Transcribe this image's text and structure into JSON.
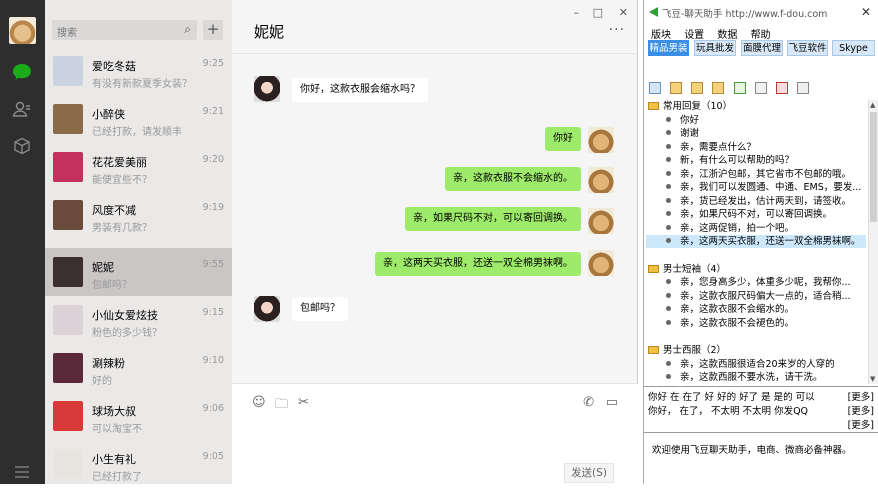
{
  "sidebar": {
    "search_placeholder": "搜索",
    "add_label": "+",
    "contacts": [
      {
        "name": "爱吃冬菇",
        "time": "9:25",
        "preview": "有没有新款夏季女装？",
        "avatar_color": "#c9d4e0"
      },
      {
        "name": "小醉侠",
        "time": "9:21",
        "preview": "已经打款，请发顺丰",
        "avatar_color": "#8b6a4a"
      },
      {
        "name": "花花爱美丽",
        "time": "9:20",
        "preview": "能便宜些不？",
        "avatar_color": "#c43060"
      },
      {
        "name": "风度不减",
        "time": "9:19",
        "preview": "男装有几款？",
        "avatar_color": "#6a4a3a"
      },
      {
        "name": "妮妮",
        "time": "9:55",
        "preview": "包邮吗？",
        "avatar_color": "#3a3030"
      },
      {
        "name": "小仙女爱炫技",
        "time": "9:15",
        "preview": "粉色的多少钱？",
        "avatar_color": "#d9d2d6"
      },
      {
        "name": "涮辣粉",
        "time": "9:10",
        "preview": "好的",
        "avatar_color": "#5a2a3a"
      },
      {
        "name": "球场大叔",
        "time": "9:06",
        "preview": "可以淘宝不",
        "avatar_color": "#d83a3a"
      },
      {
        "name": "小生有礼",
        "time": "9:05",
        "preview": "已经打款了",
        "avatar_color": "#e8e4e0"
      }
    ]
  },
  "chat": {
    "title": "妮妮",
    "more": "···",
    "window_min": "–",
    "window_max": "□",
    "window_close": "✕",
    "messages": [
      {
        "side": "left",
        "text": "你好，这款衣服会缩水吗？"
      },
      {
        "side": "right",
        "text": "你好"
      },
      {
        "side": "right",
        "text": "亲，这款衣服不会缩水的。"
      },
      {
        "side": "right",
        "text": "亲，如果尺码不对，可以寄回调换。"
      },
      {
        "side": "right",
        "text": "亲，这两天买衣服，还送一双全棉男袜啊。"
      },
      {
        "side": "left",
        "text": "包邮吗？"
      }
    ],
    "send_label": "发送(S)"
  },
  "panel": {
    "title": "飞豆-聊天助手  http://www.f-dou.com",
    "close": "✕",
    "menu": [
      "版块",
      "设置",
      "数据",
      "帮助"
    ],
    "tabs": [
      "精品男装",
      "玩具批发",
      "面膜代理",
      "飞豆软件",
      "Skype"
    ],
    "tree": [
      {
        "kind": "group",
        "text": "常用回复（10）"
      },
      {
        "kind": "item",
        "text": "你好"
      },
      {
        "kind": "item",
        "text": "谢谢"
      },
      {
        "kind": "item",
        "text": "亲，需要点什么？"
      },
      {
        "kind": "item",
        "text": "新，有什么可以帮助的吗？"
      },
      {
        "kind": "item",
        "text": "亲，江浙沪包邮，其它省市不包邮的哦。"
      },
      {
        "kind": "item",
        "text": "亲，我们可以发圆通、中通、EMS，要发..."
      },
      {
        "kind": "item",
        "text": "亲，货已经发出，估计两天到，请签收。"
      },
      {
        "kind": "item",
        "text": "亲，如果尺码不对，可以寄回调换。"
      },
      {
        "kind": "item",
        "text": "亲，这两促销，拍一个吧。"
      },
      {
        "kind": "item",
        "text": "亲，这两天买衣服，还送一双全棉男袜啊。",
        "selected": true
      },
      {
        "kind": "blank",
        "text": ""
      },
      {
        "kind": "group",
        "text": "男士短袖（4）"
      },
      {
        "kind": "item",
        "text": "亲，您身高多少，体重多少呢，我帮你..."
      },
      {
        "kind": "item",
        "text": "亲，这款衣服尺码偏大一点的，适合稍..."
      },
      {
        "kind": "item",
        "text": "亲，这款衣服不会缩水的。"
      },
      {
        "kind": "item",
        "text": "亲，这款衣服不会褪色的。"
      },
      {
        "kind": "blank",
        "text": ""
      },
      {
        "kind": "group",
        "text": "男士西服（2）"
      },
      {
        "kind": "item",
        "text": "亲，这款西服很适合20来岁的人穿的"
      },
      {
        "kind": "item",
        "text": "亲，这款西服不要水洗，请干洗。"
      }
    ],
    "quick_lines": [
      {
        "text": "你好  在  在了  好  好的  好了  是  是的  可以",
        "more": "[更多]"
      },
      {
        "text": "你好，   在了，   不太明   不太明   你发QQ",
        "more": "[更多]"
      },
      {
        "text": "",
        "more": "[更多]"
      }
    ],
    "footer": "欢迎使用飞豆聊天助手，电商、微商必备神器。"
  }
}
